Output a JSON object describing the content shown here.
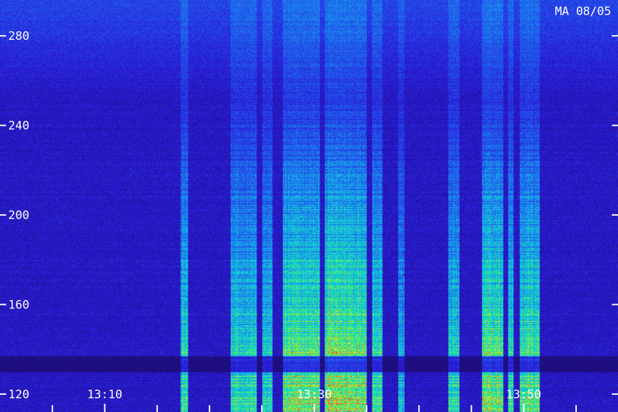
{
  "chart_data": {
    "type": "heatmap",
    "title": "MA 08/05",
    "xlabel": "",
    "ylabel": "",
    "y_ticks": [
      280,
      240,
      200,
      160,
      120
    ],
    "ylim": [
      112,
      296
    ],
    "x_ticks": [
      "13:10",
      "13:30",
      "13:50"
    ],
    "x_tick_minutes": [
      10,
      30,
      50
    ],
    "xlim_minutes": [
      0,
      59
    ],
    "x_minor_step_minutes": 5,
    "colormap": [
      "#1a0a5c",
      "#2a1ad8",
      "#1e6cf0",
      "#10d0e0",
      "#30f070",
      "#e8f020",
      "#f04020"
    ],
    "grid": false,
    "activity_bands_minutes": [
      {
        "start": 17.2,
        "end": 17.9,
        "level": 0.75
      },
      {
        "start": 22.0,
        "end": 24.5,
        "level": 0.7
      },
      {
        "start": 25.0,
        "end": 26.0,
        "level": 0.65
      },
      {
        "start": 27.0,
        "end": 30.5,
        "level": 0.9
      },
      {
        "start": 31.0,
        "end": 35.0,
        "level": 1.0
      },
      {
        "start": 35.5,
        "end": 36.5,
        "level": 0.8
      },
      {
        "start": 38.0,
        "end": 38.6,
        "level": 0.55
      },
      {
        "start": 42.8,
        "end": 43.8,
        "level": 0.7
      },
      {
        "start": 46.0,
        "end": 48.0,
        "level": 0.9
      },
      {
        "start": 48.5,
        "end": 49.0,
        "level": 0.75
      },
      {
        "start": 49.6,
        "end": 51.5,
        "level": 0.85
      }
    ],
    "dark_band_frequency": [
      130,
      137
    ]
  }
}
